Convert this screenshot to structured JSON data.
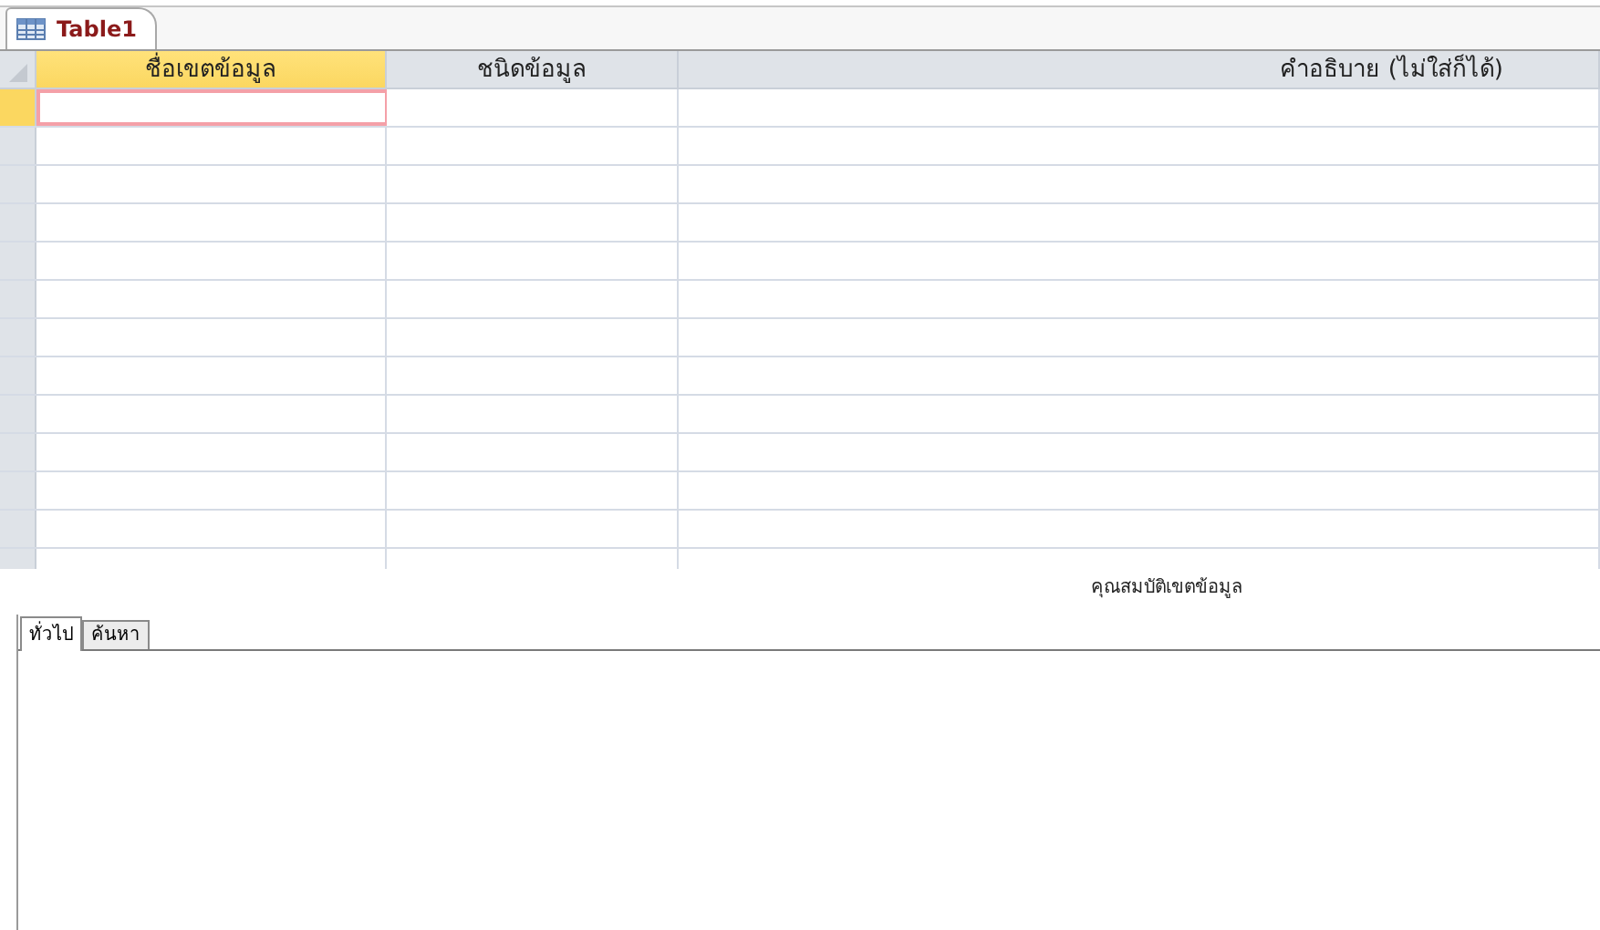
{
  "document_tab": {
    "title": "Table1"
  },
  "design_grid": {
    "columns": [
      {
        "header": "ชื่อเขตข้อมูล",
        "selected": true
      },
      {
        "header": "ชนิดข้อมูล",
        "selected": false
      },
      {
        "header": "คำอธิบาย  (ไม่ใส่ก็ได้)",
        "selected": false
      }
    ],
    "rows": [
      {
        "selected": true
      },
      {
        "selected": false
      },
      {
        "selected": false
      },
      {
        "selected": false
      },
      {
        "selected": false
      },
      {
        "selected": false
      },
      {
        "selected": false
      },
      {
        "selected": false
      },
      {
        "selected": false
      },
      {
        "selected": false
      },
      {
        "selected": false
      },
      {
        "selected": false
      },
      {
        "selected": false
      }
    ]
  },
  "field_properties": {
    "title": "คุณสมบัติเขตข้อมูล",
    "tabs": [
      {
        "label": "ทั่วไป",
        "selected": true
      },
      {
        "label": "ค้นหา",
        "selected": false
      }
    ]
  }
}
